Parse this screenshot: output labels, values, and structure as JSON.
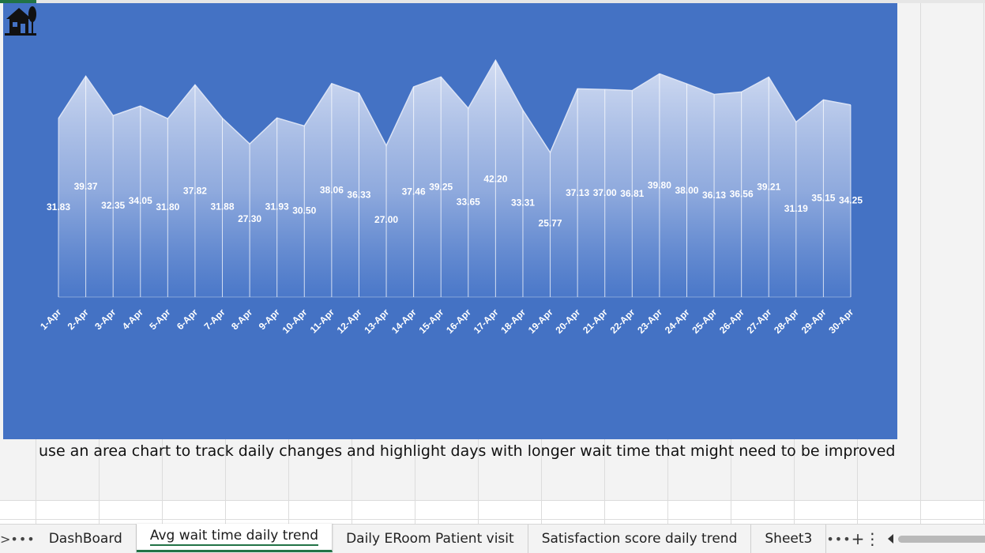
{
  "chart_data": {
    "type": "area",
    "title": "",
    "xlabel": "",
    "ylabel": "",
    "categories": [
      "1-Apr",
      "2-Apr",
      "3-Apr",
      "4-Apr",
      "5-Apr",
      "6-Apr",
      "7-Apr",
      "8-Apr",
      "9-Apr",
      "10-Apr",
      "11-Apr",
      "12-Apr",
      "13-Apr",
      "14-Apr",
      "15-Apr",
      "16-Apr",
      "17-Apr",
      "18-Apr",
      "19-Apr",
      "20-Apr",
      "21-Apr",
      "22-Apr",
      "23-Apr",
      "24-Apr",
      "25-Apr",
      "26-Apr",
      "27-Apr",
      "28-Apr",
      "29-Apr",
      "30-Apr"
    ],
    "values": [
      31.83,
      39.37,
      32.35,
      34.05,
      31.8,
      37.82,
      31.88,
      27.3,
      31.93,
      30.5,
      38.06,
      36.33,
      27.0,
      37.46,
      39.25,
      33.65,
      42.2,
      33.31,
      25.77,
      37.13,
      37.0,
      36.81,
      39.8,
      38.0,
      36.13,
      36.56,
      39.21,
      31.19,
      35.15,
      34.25
    ],
    "labels": [
      "31.83",
      "39.37",
      "32.35",
      "34.05",
      "31.80",
      "37.82",
      "31.88",
      "27.30",
      "31.93",
      "30.50",
      "38.06",
      "36.33",
      "27.00",
      "37.46",
      "39.25",
      "33.65",
      "42.20",
      "33.31",
      "25.77",
      "37.13",
      "37.00",
      "36.81",
      "39.80",
      "38.00",
      "36.13",
      "36.56",
      "39.21",
      "31.19",
      "35.15",
      "34.25"
    ],
    "ylim": [
      0,
      45
    ],
    "grid": false,
    "legend": "none",
    "colors": {
      "background": "#4472c4",
      "fill_top": "#c9d4ee",
      "line": "#dbe3f5",
      "text": "#ffffff"
    }
  },
  "chart_icon": "house-icon",
  "note": "use an area chart to track daily changes and highlight days with longer wait time that might need to be improved",
  "tabbar": {
    "nav_label": ">",
    "more_label": "•••",
    "tabs": [
      "DashBoard",
      "Avg wait time daily trend",
      "Daily ERoom Patient visit",
      "Satisfaction score daily trend",
      "Sheet3"
    ],
    "active_index": 1,
    "trailing_more_label": "•••",
    "add_label": "+",
    "options_label": "⋮"
  }
}
